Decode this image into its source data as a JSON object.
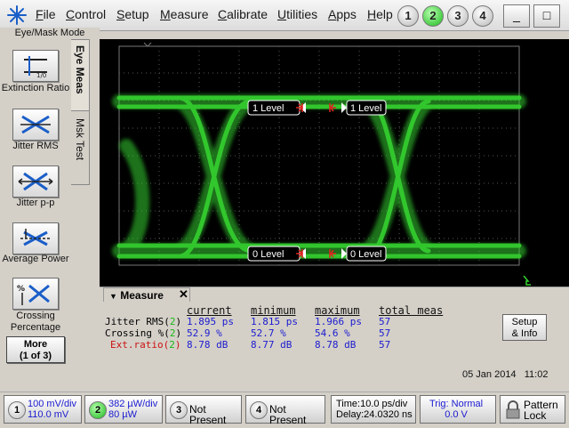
{
  "menu": {
    "items": [
      "File",
      "Control",
      "Setup",
      "Measure",
      "Calibrate",
      "Utilities",
      "Apps",
      "Help"
    ],
    "channels": [
      "1",
      "2",
      "3",
      "4"
    ],
    "minimize_label": "_",
    "close_label": "□"
  },
  "mode_label": "Eye/Mask Mode",
  "tabs": {
    "eye_meas": "Eye Meas",
    "msk_test": "Msk Test"
  },
  "sidebar": {
    "buttons": [
      {
        "label": "Extinction Ratio"
      },
      {
        "label": "Jitter RMS"
      },
      {
        "label": "Jitter p-p"
      },
      {
        "label": "Average Power"
      },
      {
        "label": "Crossing Percentage"
      }
    ],
    "more_label": "More",
    "more_sub": "(1 of 3)"
  },
  "screen": {
    "level_labels": {
      "one_left": "1 Level",
      "one_right": "1 Level",
      "zero_left": "0 Level",
      "zero_right": "0 Level"
    }
  },
  "measure": {
    "title": "Measure",
    "headers": {
      "current": "current",
      "minimum": "minimum",
      "maximum": "maximum",
      "total": "total meas"
    },
    "rows": [
      {
        "name": "Jitter RMS(",
        "ch": "2",
        "close": ")",
        "current": "1.895 ps",
        "minimum": "1.815 ps",
        "maximum": "1.966 ps",
        "total": "57",
        "color": "#111111"
      },
      {
        "name": "Crossing %(",
        "ch": "2",
        "close": ")",
        "current": "52.9 %",
        "minimum": "52.7 %",
        "maximum": "54.6 %",
        "total": "57",
        "color": "#111111"
      },
      {
        "name": "Ext.ratio(",
        "ch": "2",
        "close": ")",
        "current": "8.78 dB",
        "minimum": "8.77 dB",
        "maximum": "8.78 dB",
        "total": "57",
        "color": "#cc1111"
      }
    ],
    "setup_label": "Setup",
    "setup_sub": "& Info"
  },
  "datetime": "05 Jan 2014   11:02",
  "bottom": {
    "ch1": {
      "num": "1",
      "line1": "100 mV/div",
      "line2": "110.0 mV"
    },
    "ch2": {
      "num": "2",
      "line1": "382 µW/div",
      "line2": "80 µW"
    },
    "ch3": {
      "num": "3",
      "text": "Not Present"
    },
    "ch4": {
      "num": "4",
      "text": "Not Present"
    },
    "time": {
      "line1": "Time:10.0 ps/div",
      "line2": "Delay:24.0320 ns"
    },
    "trig": {
      "line1": "Trig: Normal",
      "line2": "0.0 V"
    },
    "pattern": {
      "line1": "Pattern",
      "line2": "Lock"
    }
  },
  "colors": {
    "trace": "#35d030",
    "screen_bg": "#000000",
    "value_blue": "#1a1ad0",
    "channel_green": "#18b818"
  }
}
